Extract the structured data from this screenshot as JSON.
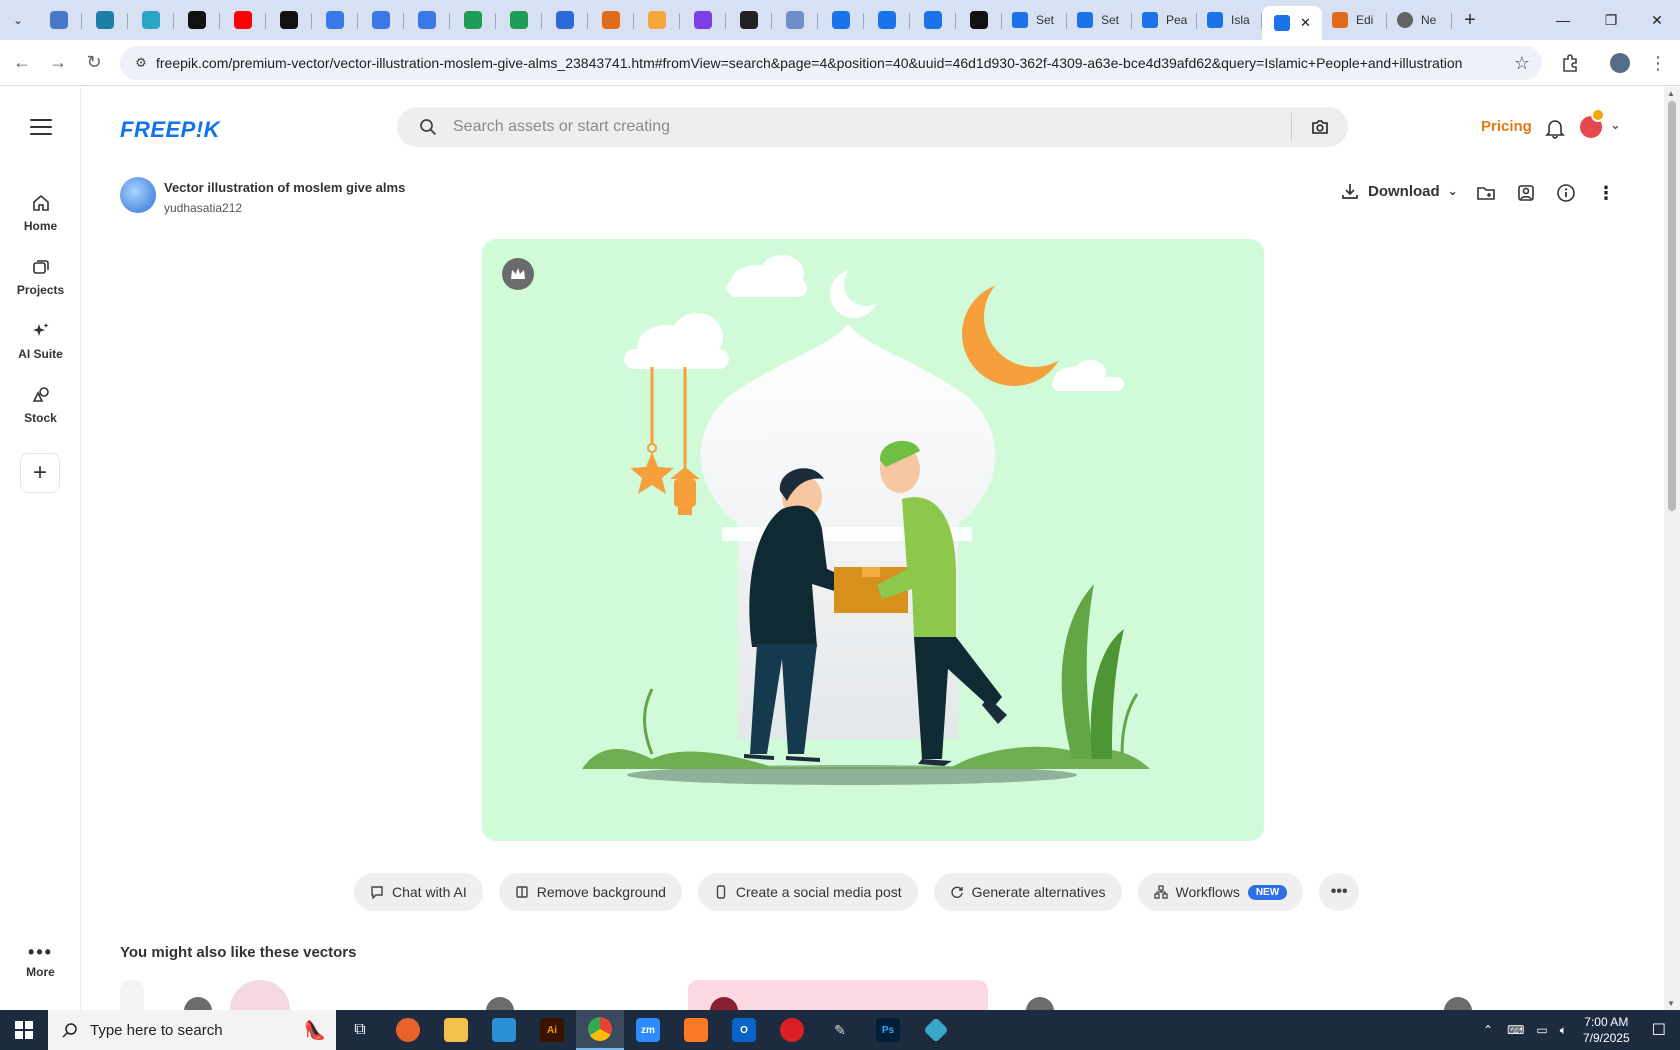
{
  "browser": {
    "tabs_favicon_only": [
      {
        "icon": "circle-app-icon",
        "color": "#4a78c8"
      },
      {
        "icon": "vpn-icon",
        "color": "#1e7fa6"
      },
      {
        "icon": "diamond-app-icon",
        "color": "#2aa6c4"
      },
      {
        "icon": "openai-icon",
        "color": "#111111"
      },
      {
        "icon": "youtube-icon",
        "color": "#ff0000"
      },
      {
        "icon": "bolt-icon",
        "color": "#111111"
      },
      {
        "icon": "docs-icon",
        "color": "#3b78e7"
      },
      {
        "icon": "docs-icon",
        "color": "#3b78e7"
      },
      {
        "icon": "docs-icon",
        "color": "#3b78e7"
      },
      {
        "icon": "sheets-icon",
        "color": "#1f9d55"
      },
      {
        "icon": "sheets-icon",
        "color": "#1f9d55"
      },
      {
        "icon": "word-app-icon",
        "color": "#2b68d8"
      },
      {
        "icon": "xampp-icon",
        "color": "#e06b1b"
      },
      {
        "icon": "v-icon",
        "color": "#f2a63b"
      },
      {
        "icon": "brackets-icon",
        "color": "#7b3fe4"
      },
      {
        "icon": "a-icon",
        "color": "#222222"
      },
      {
        "icon": "grid-app-icon",
        "color": "#6d90c9"
      },
      {
        "icon": "forms-icon",
        "color": "#1a73e8"
      },
      {
        "icon": "forms-icon",
        "color": "#1a73e8"
      },
      {
        "icon": "forms-icon",
        "color": "#1a73e8"
      },
      {
        "icon": "m-icon",
        "color": "#111111"
      }
    ],
    "tabs_titled": [
      {
        "label": "Set",
        "color": "#1a73e8"
      },
      {
        "label": "Set",
        "color": "#1a73e8"
      },
      {
        "label": "Pea",
        "color": "#1a73e8"
      },
      {
        "label": "Isla",
        "color": "#1a73e8"
      }
    ],
    "active_tab_close": "✕",
    "tabs_after": [
      {
        "label": "Edi",
        "color": "#e06b1b"
      },
      {
        "label": "Ne",
        "color": "#5f6368"
      }
    ],
    "new_tab": "+",
    "url": "freepik.com/premium-vector/vector-illustration-moslem-give-alms_23843741.htm#fromView=search&page=4&position=40&uuid=46d1d930-362f-4309-a63e-bce4d39afd62&query=Islamic+People+and+illustration"
  },
  "nav": {
    "home": "Home",
    "projects": "Projects",
    "ai_suite": "AI Suite",
    "stock": "Stock",
    "more": "More"
  },
  "header": {
    "logo": "FREEP!K",
    "search_placeholder": "Search assets or start creating",
    "pricing": "Pricing",
    "accent": "#e07b17",
    "brand": "#1273eb"
  },
  "resource": {
    "title": "Vector illustration of moslem give alms",
    "author": "yudhasatia212",
    "download": "Download"
  },
  "actions": {
    "chat": "Chat with AI",
    "remove_bg": "Remove background",
    "social": "Create a social media post",
    "alternatives": "Generate alternatives",
    "workflows": "Workflows",
    "new_badge": "NEW"
  },
  "related_heading": "You might also like these vectors",
  "taskbar": {
    "search_placeholder": "Type here to search",
    "time": "7:00 AM",
    "date": "7/9/2025"
  }
}
